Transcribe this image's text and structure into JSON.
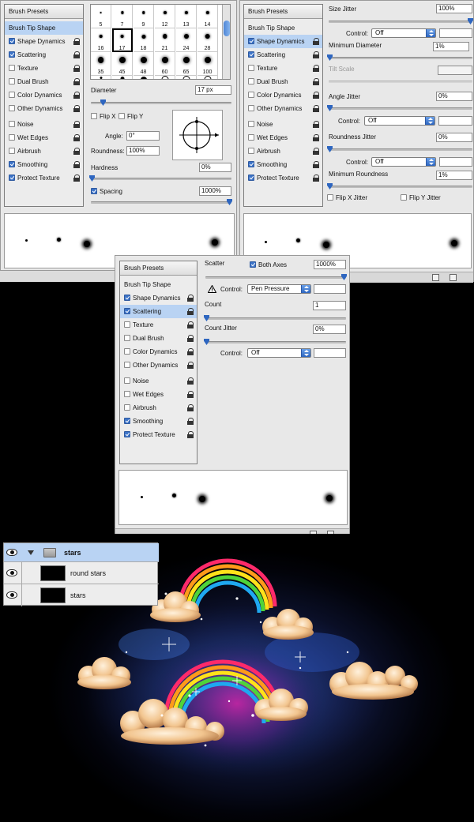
{
  "panels": {
    "list_header": "Brush Presets",
    "items": [
      {
        "label": "Brush Tip Shape",
        "checkbox": false,
        "lock": false
      },
      {
        "label": "Shape Dynamics",
        "checkbox": true,
        "lock": true
      },
      {
        "label": "Scattering",
        "checkbox": true,
        "lock": true
      },
      {
        "label": "Texture",
        "checkbox": false,
        "lock": true
      },
      {
        "label": "Dual Brush",
        "checkbox": false,
        "lock": true
      },
      {
        "label": "Color Dynamics",
        "checkbox": false,
        "lock": true
      },
      {
        "label": "Other Dynamics",
        "checkbox": false,
        "lock": true
      },
      {
        "label": "Noise",
        "checkbox": false,
        "lock": true
      },
      {
        "label": "Wet Edges",
        "checkbox": false,
        "lock": true
      },
      {
        "label": "Airbrush",
        "checkbox": false,
        "lock": true
      },
      {
        "label": "Smoothing",
        "checkbox": true,
        "lock": true
      },
      {
        "label": "Protect Texture",
        "checkbox": true,
        "lock": true
      }
    ]
  },
  "tip": {
    "brush_sizes": [
      "5",
      "7",
      "9",
      "12",
      "13",
      "14",
      "16",
      "17",
      "18",
      "21",
      "24",
      "28",
      "35",
      "45",
      "48",
      "60",
      "65",
      "100"
    ],
    "selected_size": "17",
    "diameter_label": "Diameter",
    "diameter_value": "17 px",
    "flip_x": "Flip X",
    "flip_y": "Flip Y",
    "angle_label": "Angle:",
    "angle_value": "0°",
    "roundness_label": "Roundness:",
    "roundness_value": "100%",
    "hardness_label": "Hardness",
    "hardness_value": "0%",
    "spacing_label": "Spacing",
    "spacing_value": "1000%"
  },
  "shape": {
    "size_jitter_label": "Size Jitter",
    "size_jitter_value": "100%",
    "control_label": "Control:",
    "control_value": "Off",
    "min_diameter_label": "Minimum Diameter",
    "min_diameter_value": "1%",
    "tilt_scale_label": "Tilt Scale",
    "angle_jitter_label": "Angle Jitter",
    "angle_jitter_value": "0%",
    "roundness_jitter_label": "Roundness Jitter",
    "roundness_jitter_value": "0%",
    "min_roundness_label": "Minimum Roundness",
    "min_roundness_value": "1%",
    "flip_x_jitter": "Flip X Jitter",
    "flip_y_jitter": "Flip Y Jitter"
  },
  "scatter": {
    "scatter_label": "Scatter",
    "both_axes_label": "Both Axes",
    "scatter_value": "1000%",
    "control_label": "Control:",
    "control_value": "Pen Pressure",
    "count_label": "Count",
    "count_value": "1",
    "count_jitter_label": "Count Jitter",
    "count_jitter_value": "0%",
    "control2_value": "Off"
  },
  "layers": {
    "group_name": "stars",
    "layer1": "round stars",
    "layer2": "stars"
  },
  "colors": {
    "selection": "#b9d3f3",
    "accent": "#2e66c0"
  }
}
